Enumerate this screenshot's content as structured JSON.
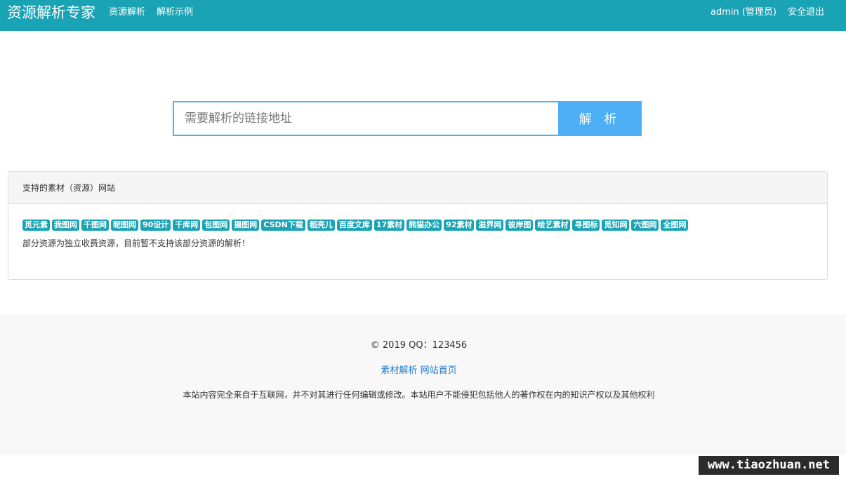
{
  "navbar": {
    "brand": "资源解析专家",
    "links": [
      "资源解析",
      "解析示例"
    ],
    "user": "admin (管理员)",
    "logout": "安全退出",
    "color": "#1aa3b5"
  },
  "search": {
    "placeholder": "需要解析的链接地址",
    "button_label": "解 析",
    "button_color": "#4db0f6"
  },
  "panel": {
    "heading": "支持的素材（资源）网站",
    "tags": [
      "觅元素",
      "我图网",
      "千图网",
      "昵图网",
      "90设计",
      "千库网",
      "包图网",
      "摄图网",
      "CSDN下载",
      "稻壳儿",
      "百度文库",
      "17素材",
      "熊猫办公",
      "92素材",
      "滋界网",
      "彼岸图",
      "绘艺素材",
      "寻图标",
      "觅知网",
      "六图网",
      "全图网"
    ],
    "note": "部分资源为独立收费资源，目前暂不支持该部分资源的解析！"
  },
  "footer": {
    "copyright": "© 2019 QQ：123456",
    "link1": "素材解析",
    "link2": "网站首页",
    "disclaimer": "本站内容完全来自于互联网，并不对其进行任何编辑或修改。本站用户不能侵犯包括他人的著作权在内的知识产权以及其他权利"
  },
  "watermark": "www.tiaozhuan.net"
}
